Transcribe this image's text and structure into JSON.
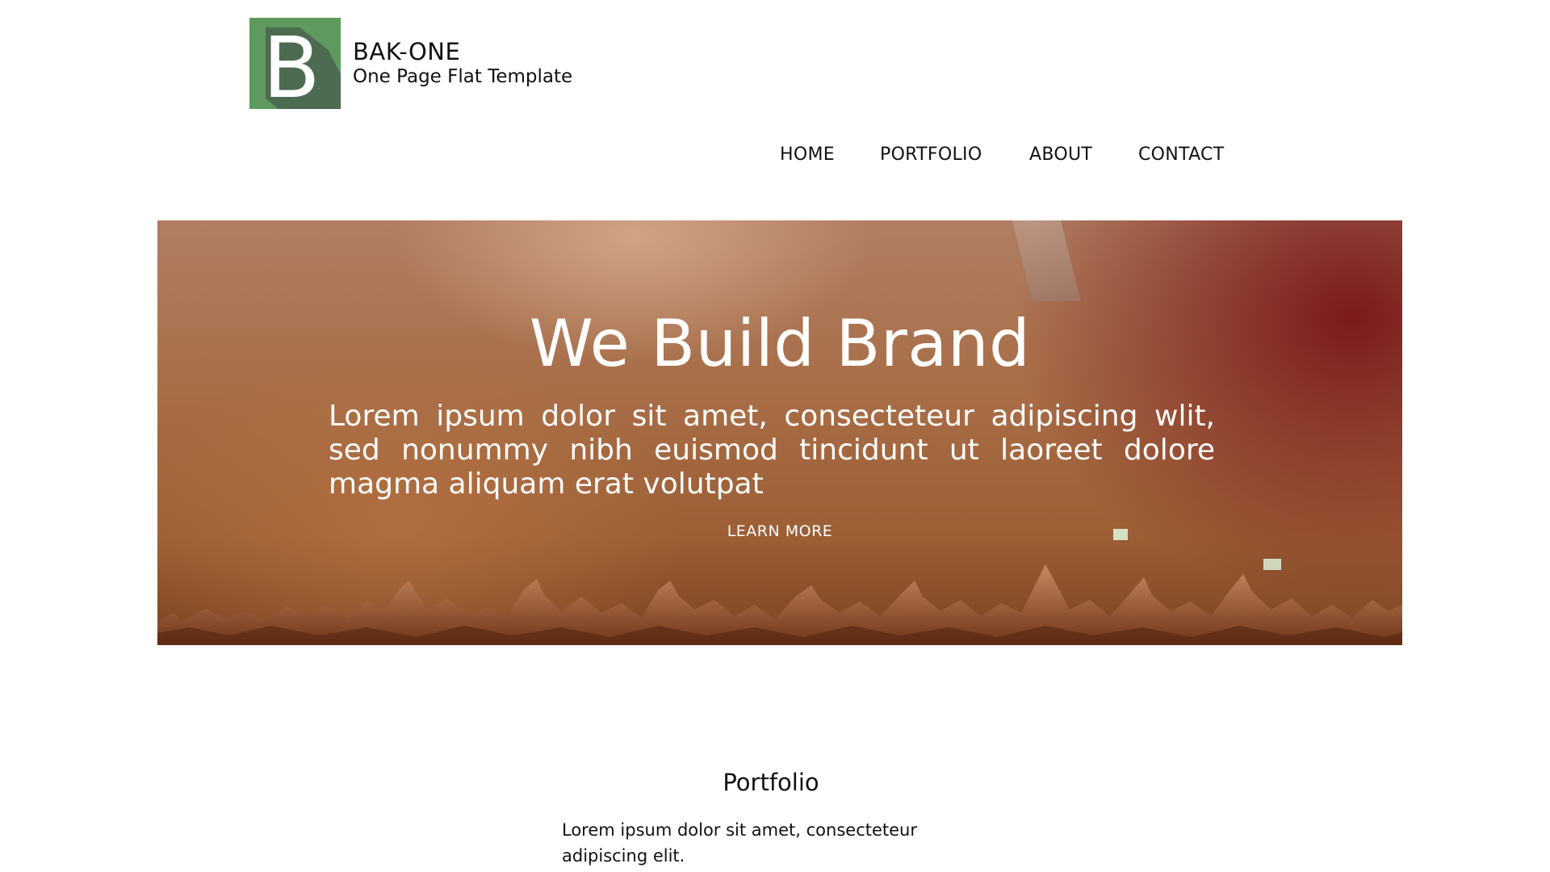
{
  "brand": {
    "logo_letter": "B",
    "title": "BAK-ONE",
    "subtitle": "One Page Flat Template",
    "logo_color": "#5e9a5e"
  },
  "nav": {
    "items": [
      {
        "label": "HOME"
      },
      {
        "label": "PORTFOLIO"
      },
      {
        "label": "ABOUT"
      },
      {
        "label": "CONTACT"
      }
    ]
  },
  "hero": {
    "title": "We Build Brand",
    "text": "Lorem ipsum dolor sit amet, consecteteur adipiscing wlit, sed nonummy nibh euismod tincidunt ut laoreet dolore magma aliquam erat volutpat",
    "button_label": "LEARN MORE",
    "image": "concert-crowd-photo"
  },
  "portfolio": {
    "title": "Portfolio",
    "text": "Lorem ipsum dolor sit amet, consecteteur adipiscing elit."
  }
}
